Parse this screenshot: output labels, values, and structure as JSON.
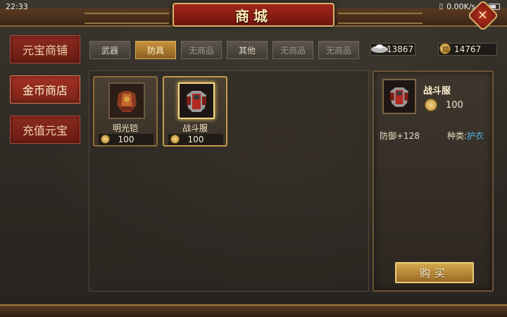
{
  "status_bar": {
    "time": "22:33",
    "speed": "0.00K/s",
    "battery_label": "80"
  },
  "header": {
    "title": "商城",
    "close_icon": "close-icon"
  },
  "side_tabs": [
    {
      "label": "元宝商铺",
      "active": false
    },
    {
      "label": "金币商店",
      "active": true
    },
    {
      "label": "充值元宝",
      "active": false
    }
  ],
  "category_tabs": [
    {
      "label": "武器",
      "state": "normal"
    },
    {
      "label": "防具",
      "state": "active"
    },
    {
      "label": "无商品",
      "state": "disabled"
    },
    {
      "label": "其他",
      "state": "normal"
    },
    {
      "label": "无商品",
      "state": "disabled"
    },
    {
      "label": "无商品",
      "state": "disabled"
    }
  ],
  "currency": {
    "ingot_amount": "13867",
    "coin_amount": "14767"
  },
  "items": [
    {
      "name": "明光铠",
      "price": "100",
      "icon": "armor-icon",
      "selected": false
    },
    {
      "name": "战斗服",
      "price": "100",
      "icon": "battle-suit-icon",
      "selected": true
    }
  ],
  "detail": {
    "name": "战斗服",
    "price": "100",
    "stat": "防御+128",
    "kind_label": "种类:",
    "kind_value": "护衣",
    "buy_label": "购买"
  },
  "colors": {
    "accent_gold": "#c8923c",
    "title_red": "#a2261c",
    "kind_blue": "#4fb0e6"
  }
}
